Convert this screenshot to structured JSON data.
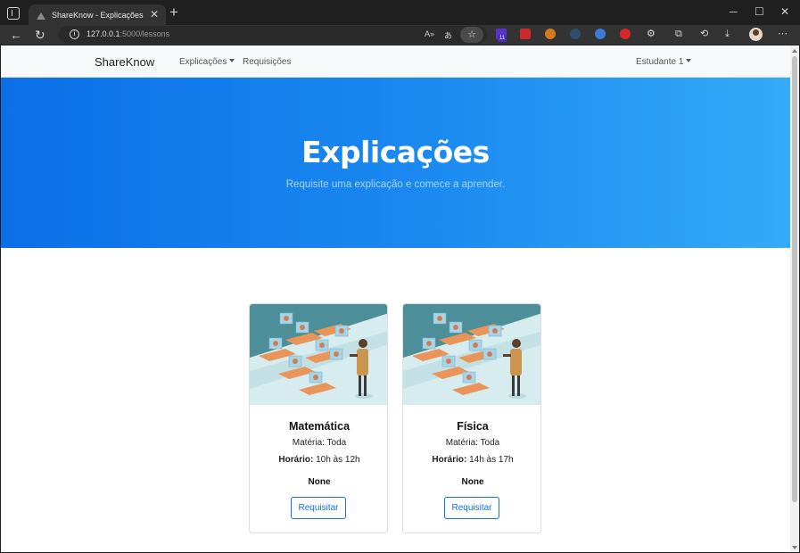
{
  "browser": {
    "tab_title": "ShareKnow - Explicações",
    "url_host": "127.0.0.1",
    "url_path": ":5000/lessons",
    "extension_badge": "11",
    "icons": [
      "sidebar-toggle-icon",
      "back-icon",
      "refresh-icon",
      "info-icon",
      "read-aloud-icon",
      "translate-icon",
      "favorites-star-icon",
      "extensions-icon",
      "split-screen-icon",
      "collections-icon",
      "history-icon",
      "downloads-icon",
      "profile-avatar-icon",
      "more-menu-icon"
    ]
  },
  "navbar": {
    "brand": "ShareKnow",
    "links": {
      "explicacoes": "Explicações",
      "requisicoes": "Requisições"
    },
    "user": "Estudante 1"
  },
  "hero": {
    "title": "Explicações",
    "subtitle": "Requisite uma explicação e comece a aprender."
  },
  "cards": [
    {
      "title": "Matemática",
      "materia_label": "Matéria:",
      "materia_value": "Toda",
      "horario_label": "Horário:",
      "horario_value": "10h às 12h",
      "note": "None",
      "button": "Requisitar"
    },
    {
      "title": "Física",
      "materia_label": "Matéria:",
      "materia_value": "Toda",
      "horario_label": "Horário:",
      "horario_value": "14h às 17h",
      "note": "None",
      "button": "Requisitar"
    }
  ],
  "colors": {
    "hero_gradient_start": "#0b6fe8",
    "hero_gradient_end": "#35aaf8",
    "button_primary": "#0d6efd",
    "card_image_bg": "#4c8f99"
  }
}
